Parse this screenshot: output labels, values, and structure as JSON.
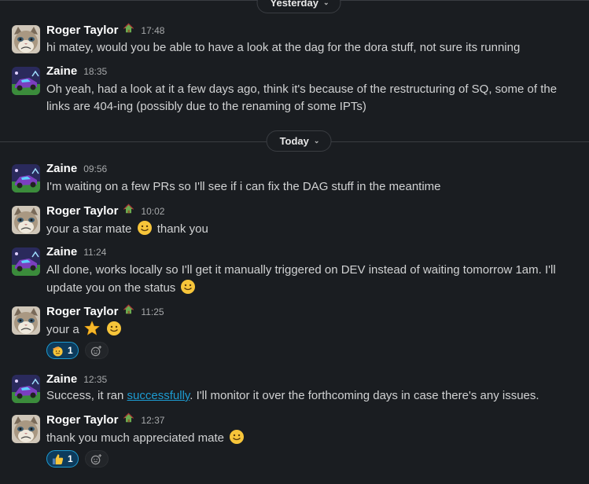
{
  "dividers": {
    "yesterday": "Yesterday",
    "today": "Today"
  },
  "users": {
    "roger": "Roger Taylor",
    "zaine": "Zaine"
  },
  "messages": [
    {
      "author": "Roger Taylor",
      "time": "17:48",
      "text": "hi matey, would you be able to have a look at the dag for the dora stuff, not sure its running"
    },
    {
      "author": "Zaine",
      "time": "18:35",
      "text": "Oh yeah, had a look at it a few days ago, think it's because of the restructuring of SQ, some of the links are 404-ing (possibly due to the renaming of some IPTs)"
    },
    {
      "author": "Zaine",
      "time": "09:56",
      "text": "I'm waiting on a few PRs so I'll see if i can fix the DAG stuff in the meantime"
    },
    {
      "author": "Roger Taylor",
      "time": "10:02",
      "text_before": "your a star mate",
      "text_after": "thank you"
    },
    {
      "author": "Zaine",
      "time": "11:24",
      "text": "All done, works locally so I'll get it manually triggered on DEV instead of waiting tomorrow 1am. I'll update you on the status"
    },
    {
      "author": "Roger Taylor",
      "time": "11:25",
      "text": "your a",
      "reaction": {
        "emoji": "saluting-face",
        "count": "1"
      }
    },
    {
      "author": "Zaine",
      "time": "12:35",
      "text_before": "Success, it ran ",
      "link": "successfully",
      "text_after": ". I'll monitor it over the forthcoming days in case there's any issues."
    },
    {
      "author": "Roger Taylor",
      "time": "12:37",
      "text": "thank you much appreciated mate",
      "reaction": {
        "emoji": "thumbs-up",
        "count": "1"
      }
    }
  ],
  "colors": {
    "background": "#1a1d21",
    "text": "#d1d2d3",
    "link": "#1d9bd1",
    "reaction_bg": "#0d3b5c",
    "reaction_border": "#1d9bd1"
  }
}
